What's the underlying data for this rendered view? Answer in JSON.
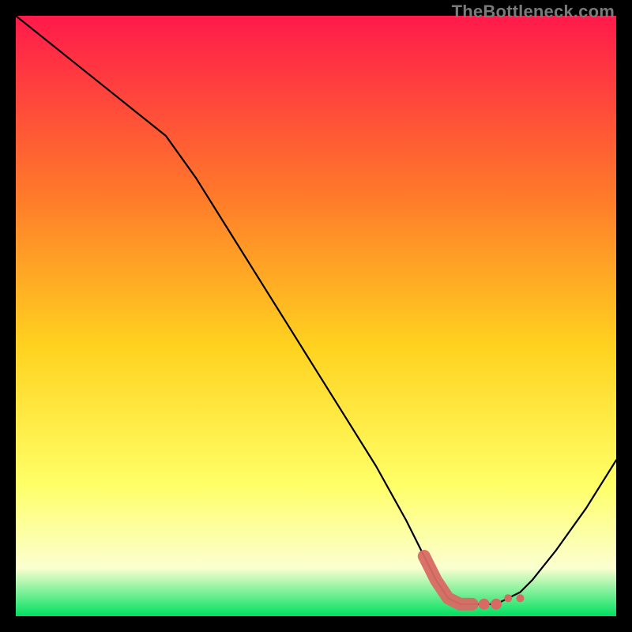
{
  "watermark": "TheBottleneck.com",
  "colors": {
    "gradient_top": "#ff1a4b",
    "gradient_mid1": "#ff7a2a",
    "gradient_mid2": "#ffd21f",
    "gradient_mid3": "#ffff66",
    "gradient_mid4": "#fbffd0",
    "gradient_bottom": "#00e060",
    "curve": "#000000",
    "marker": "#d86a64"
  },
  "chart_data": {
    "type": "line",
    "title": "",
    "xlabel": "",
    "ylabel": "",
    "xlim": [
      0,
      100
    ],
    "ylim": [
      0,
      100
    ],
    "series": [
      {
        "name": "bottleneck-curve",
        "x": [
          0,
          5,
          10,
          15,
          20,
          25,
          30,
          35,
          40,
          45,
          50,
          55,
          60,
          65,
          68,
          70,
          72,
          74,
          76,
          78,
          80,
          82,
          84,
          86,
          90,
          95,
          100
        ],
        "y": [
          100,
          96,
          92,
          88,
          84,
          80,
          73,
          65,
          57,
          49,
          41,
          33,
          25,
          16,
          10,
          6,
          3,
          2,
          2,
          2,
          2,
          3,
          4,
          6,
          11,
          18,
          26
        ]
      }
    ],
    "markers": {
      "name": "highlight-band",
      "x": [
        68,
        70,
        72,
        74,
        76,
        78,
        80,
        82,
        84
      ],
      "y": [
        10,
        6,
        3,
        2,
        2,
        2,
        2,
        3,
        3
      ]
    }
  }
}
